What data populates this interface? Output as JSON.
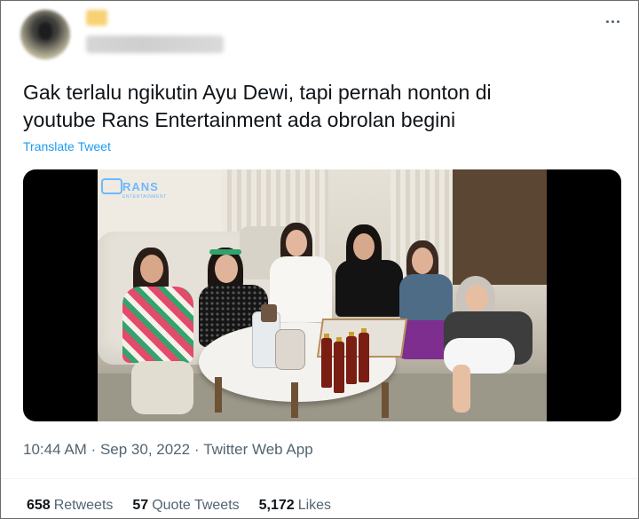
{
  "tweet": {
    "text": "Gak terlalu ngikutin Ayu Dewi, tapi pernah nonton di\nyoutube Rans Entertainment ada obrolan begini",
    "translate_label": "Translate Tweet",
    "media": {
      "logo_text": "RANS",
      "logo_subtext": "ENTERTAINMENT"
    },
    "time": "10:44 AM",
    "separator": " · ",
    "date": "Sep 30, 2022",
    "source": "Twitter Web App",
    "stats": {
      "retweets_count": "658",
      "retweets_label": "Retweets",
      "quotes_count": "57",
      "quotes_label": "Quote Tweets",
      "likes_count": "5,172",
      "likes_label": "Likes"
    }
  },
  "colors": {
    "link": "#1d9bf0",
    "secondary_text": "#536471",
    "primary_text": "#0f1419"
  },
  "icons": {
    "more": "more-horizontal-icon"
  }
}
